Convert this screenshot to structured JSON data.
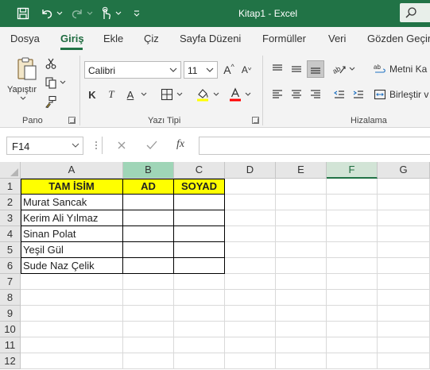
{
  "titlebar": {
    "title": "Kitap1 - Excel"
  },
  "tabs": [
    {
      "label": "Dosya"
    },
    {
      "label": "Giriş"
    },
    {
      "label": "Ekle"
    },
    {
      "label": "Çiz"
    },
    {
      "label": "Sayfa Düzeni"
    },
    {
      "label": "Formüller"
    },
    {
      "label": "Veri"
    },
    {
      "label": "Gözden Geçir"
    }
  ],
  "ribbon": {
    "paste_label": "Yapıştır",
    "font_name": "Calibri",
    "font_size": "11",
    "bold": "K",
    "italic": "T",
    "underline": "A",
    "increase_font": "A",
    "decrease_font": "A",
    "fx": "fx",
    "wrap_text_label": "Metni Ka",
    "merge_label": "Birleştir v",
    "groups": {
      "clipboard": "Pano",
      "font": "Yazı Tipi",
      "alignment": "Hizalama"
    },
    "highlight_color": "#ffff00",
    "font_color": "#ff0000"
  },
  "formula_bar": {
    "name_box": "F14",
    "formula": ""
  },
  "sheet": {
    "columns": [
      "A",
      "B",
      "C",
      "D",
      "E",
      "F",
      "G"
    ],
    "selected_column": "F",
    "rows": [
      "1",
      "2",
      "3",
      "4",
      "5",
      "6",
      "7",
      "8",
      "9",
      "10",
      "11",
      "12"
    ],
    "header": {
      "a": "TAM İSİM",
      "b": "AD",
      "c": "SOYAD"
    },
    "names": [
      "Murat Sancak",
      "Kerim Ali Yılmaz",
      "Sinan Polat",
      "Yeşil Gül",
      "Sude Naz Çelik"
    ],
    "header_fill": "#ffff00"
  }
}
